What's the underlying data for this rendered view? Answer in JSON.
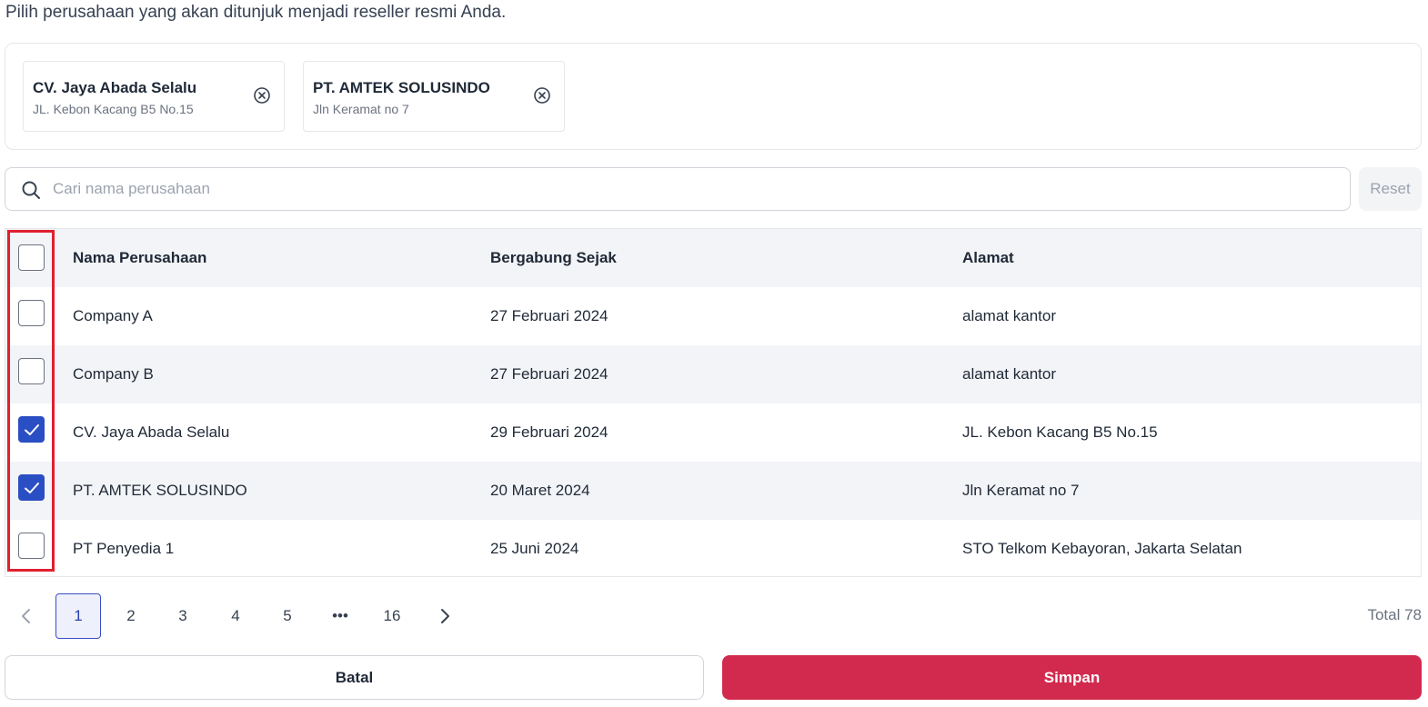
{
  "intro_text": "Pilih perusahaan yang akan ditunjuk menjadi reseller resmi Anda.",
  "selected": [
    {
      "name": "CV. Jaya Abada Selalu",
      "address": "JL. Kebon Kacang B5 No.15"
    },
    {
      "name": "PT. AMTEK SOLUSINDO",
      "address": "Jln Keramat no 7"
    }
  ],
  "search": {
    "placeholder": "Cari nama perusahaan",
    "value": ""
  },
  "reset_label": "Reset",
  "table": {
    "headers": {
      "name": "Nama Perusahaan",
      "joined": "Bergabung Sejak",
      "address": "Alamat"
    },
    "header_checked": false,
    "rows": [
      {
        "name": "Company A",
        "joined": "27 Februari 2024",
        "address": "alamat kantor",
        "checked": false
      },
      {
        "name": "Company B",
        "joined": "27 Februari 2024",
        "address": "alamat kantor",
        "checked": false
      },
      {
        "name": "CV. Jaya Abada Selalu",
        "joined": "29 Februari 2024",
        "address": "JL. Kebon Kacang B5 No.15",
        "checked": true
      },
      {
        "name": "PT. AMTEK SOLUSINDO",
        "joined": "20 Maret 2024",
        "address": "Jln Keramat no 7",
        "checked": true
      },
      {
        "name": "PT Penyedia 1",
        "joined": "25 Juni 2024",
        "address": "STO Telkom Kebayoran, Jakarta Selatan",
        "checked": false
      }
    ]
  },
  "pagination": {
    "pages": [
      "1",
      "2",
      "3",
      "4",
      "5",
      "•••",
      "16"
    ],
    "current": "1",
    "total_text": "Total 78"
  },
  "buttons": {
    "cancel": "Batal",
    "save": "Simpan"
  },
  "colors": {
    "primary": "#2a4ec3",
    "save": "#d22a4e",
    "highlight": "#e0202e"
  },
  "icons": {
    "remove": "close-circle-icon",
    "search": "search-icon",
    "prev": "chevron-left-icon",
    "next": "chevron-right-icon",
    "check": "check-icon"
  }
}
